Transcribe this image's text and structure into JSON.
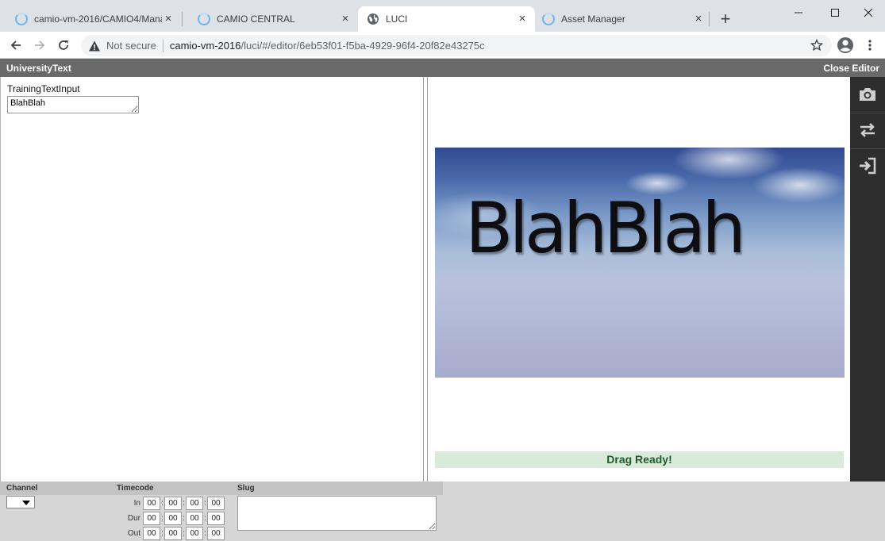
{
  "browser": {
    "tabs": [
      {
        "title": "camio-vm-2016/CAMIO4/Manag",
        "icon": "camio-loading-icon",
        "active": false
      },
      {
        "title": "CAMIO CENTRAL",
        "icon": "camio-loading-icon",
        "active": false
      },
      {
        "title": "LUCI",
        "icon": "globe-icon",
        "active": true
      },
      {
        "title": "Asset Manager",
        "icon": "camio-loading-icon",
        "active": false
      }
    ],
    "close_glyph": "×",
    "new_tab_glyph": "+",
    "security_label": "Not secure",
    "url_host": "camio-vm-2016",
    "url_path": "/luci/#/editor/6eb53f01-f5ba-4929-96f4-20f82e43275c"
  },
  "app": {
    "title": "UniversityText",
    "close_editor": "Close Editor"
  },
  "form": {
    "field_label": "TrainingTextInput",
    "field_value": "BlahBlah"
  },
  "preview": {
    "text": "BlahBlah",
    "status": "Drag Ready!",
    "status_color": "#d9eadb"
  },
  "sidebar_icons": [
    "camera-icon",
    "swap-icon",
    "sign-in-icon"
  ],
  "bottom": {
    "channel_label": "Channel",
    "timecode_label": "Timecode",
    "slug_label": "Slug",
    "rows": [
      {
        "label": "In",
        "values": [
          "00",
          "00",
          "00",
          "00"
        ]
      },
      {
        "label": "Dur",
        "values": [
          "00",
          "00",
          "00",
          "00"
        ]
      },
      {
        "label": "Out",
        "values": [
          "00",
          "00",
          "00",
          "00"
        ]
      }
    ],
    "separator": ":"
  }
}
